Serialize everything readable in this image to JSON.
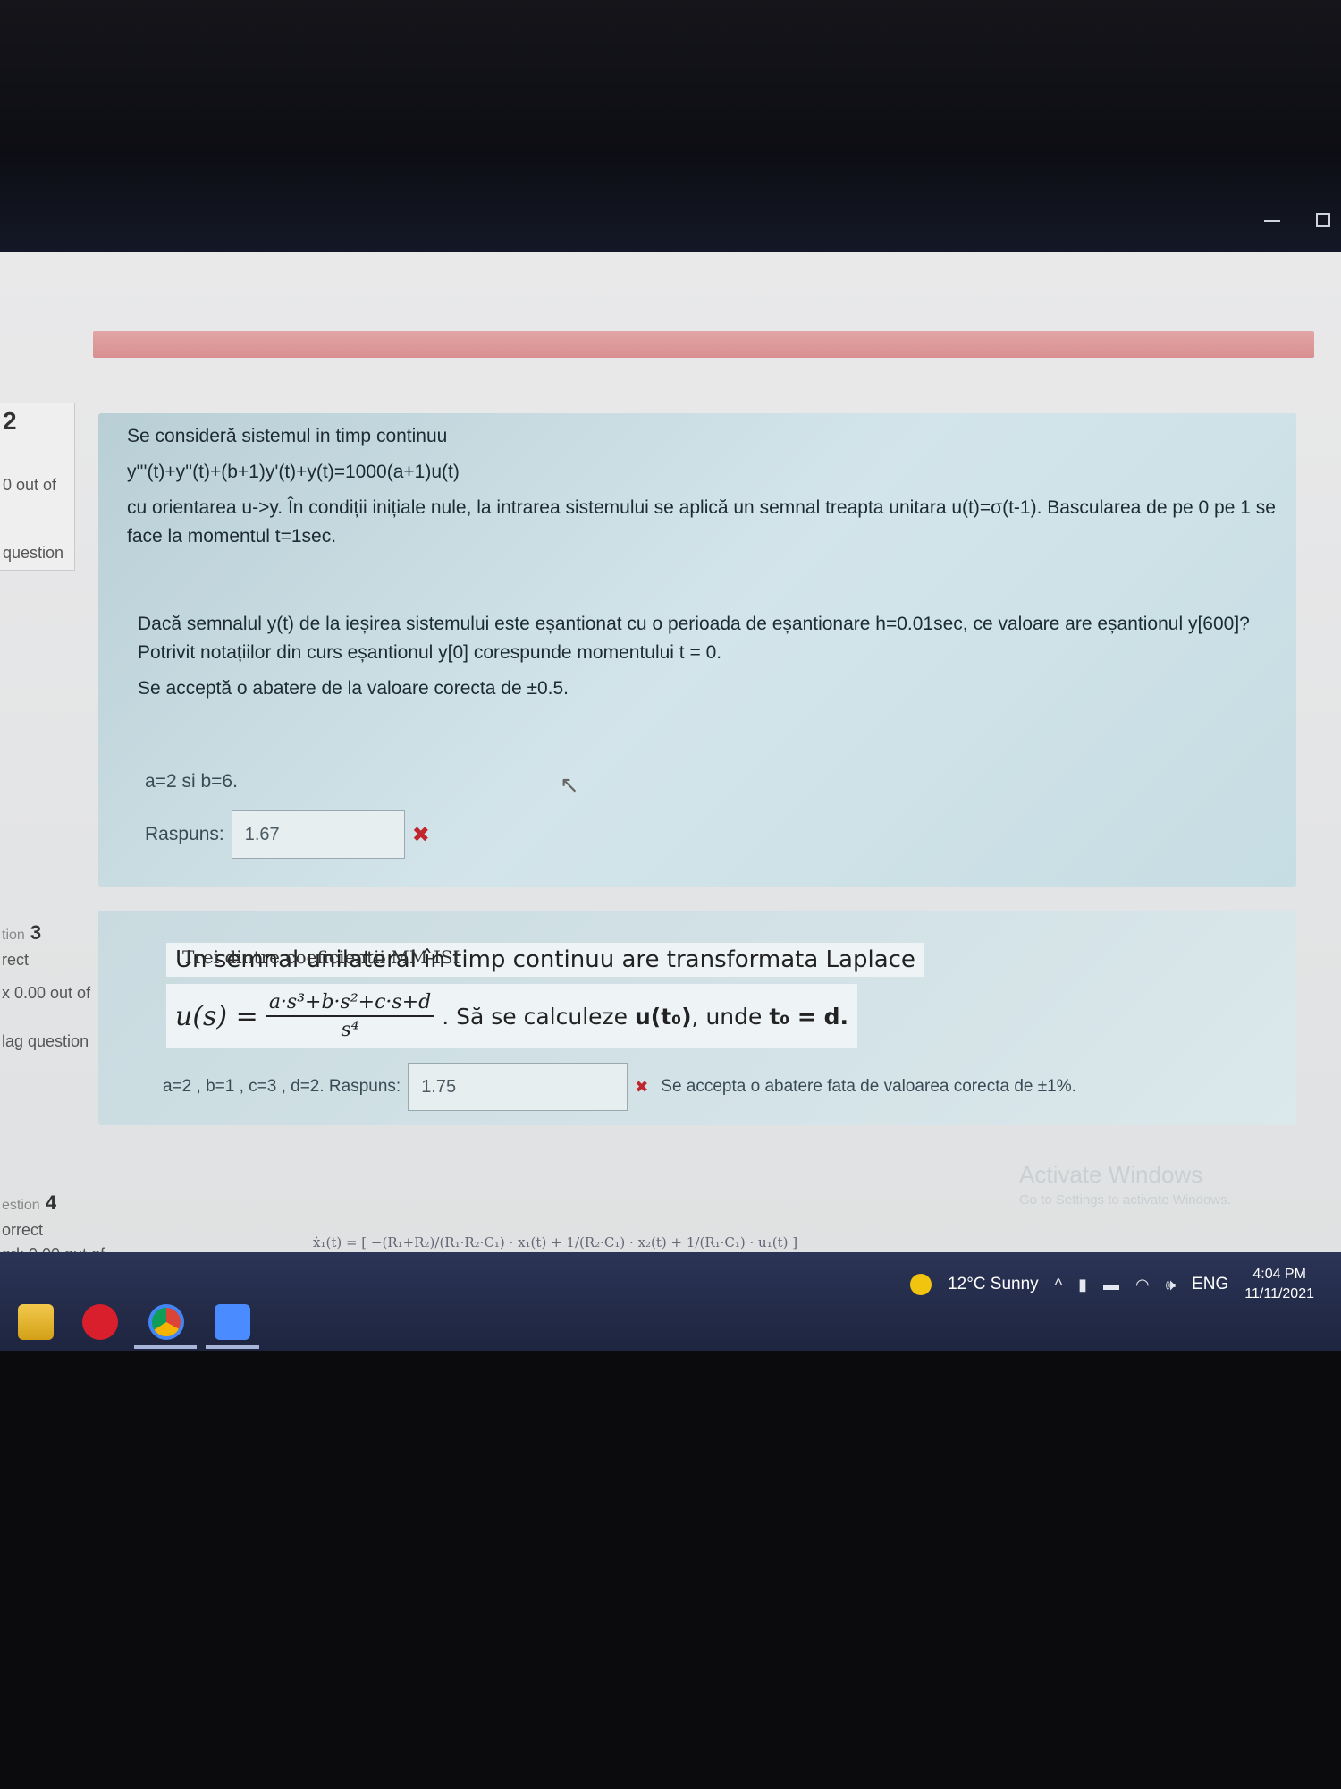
{
  "window": {
    "minimize_label": "—",
    "maximize_label": ""
  },
  "questions": {
    "q2": {
      "nav_number": "2",
      "nav_score": "0 out of",
      "nav_flag": "question",
      "line1": "Se consideră sistemul in timp continuu",
      "line2": "y'''(t)+y''(t)+(b+1)y'(t)+y(t)=1000(a+1)u(t)",
      "line3": "cu orientarea u->y. În condiții inițiale nule, la intrarea sistemului se aplică un semnal treapta unitara u(t)=σ(t-1). Bascularea de pe 0 pe 1 se face la momentul t=1sec.",
      "line4": "Dacă semnalul y(t) de la ieșirea sistemului este eșantionat cu o perioada de eșantionare h=0.01sec, ce valoare are eșantionul y[600]?  Potrivit notațiilor din curs eșantionul y[0] corespunde momentului t = 0.",
      "line5": "Se acceptă o abatere de la valoare corecta de ±0.5.",
      "params": "a=2 si b=6.",
      "answer_label": "Raspuns:",
      "answer_value": "1.67",
      "status_icon": "✖"
    },
    "q3": {
      "nav_number": "3",
      "nav_prefix": "tion",
      "nav_status": "rect",
      "nav_score": "x 0.00 out of",
      "nav_flag": "lag question",
      "heading": "Un semnal unilateral în timp continuu are transformata Laplace",
      "formula_lhs": "u(s) =",
      "formula_num": "a·s³+b·s²+c·s+d",
      "formula_den": "s⁴",
      "formula_rest_pre": ". Să se calculeze ",
      "formula_rest_bold1": "u(t₀)",
      "formula_rest_mid": ", unde ",
      "formula_rest_bold2": "t₀ = d.",
      "params": "a=2 , b=1 , c=3 , d=2. Raspuns:",
      "answer_value": "1.75",
      "status_icon": "✖",
      "tolerance": "Se accepta o abatere fata de valoarea corecta de ±1%."
    },
    "q4": {
      "nav_prefix": "estion",
      "nav_number": "4",
      "nav_status": "orrect",
      "nav_score": "ark 0.00 out of",
      "title": "Trei dintre coeficienții MM-ISI",
      "equation": "ẋ₁(t) = [ −(R₁+R₂)/(R₁·R₂·C₁) · x₁(t) + 1/(R₂·C₁) · x₂(t) + 1/(R₁·C₁) · u₁(t) ]"
    }
  },
  "watermark": {
    "line1": "Activate Windows",
    "line2": "Go to Settings to activate Windows."
  },
  "taskbar": {
    "weather": "12°C  Sunny",
    "lang": "ENG",
    "time": "4:04 PM",
    "date": "11/11/2021",
    "apps": [
      "file-explorer",
      "opera",
      "chrome",
      "zoom"
    ]
  },
  "colors": {
    "alert": "#d88f8f",
    "panel": "#c6dde3",
    "wrong": "#c0262d",
    "taskbar": "#2b3456"
  }
}
